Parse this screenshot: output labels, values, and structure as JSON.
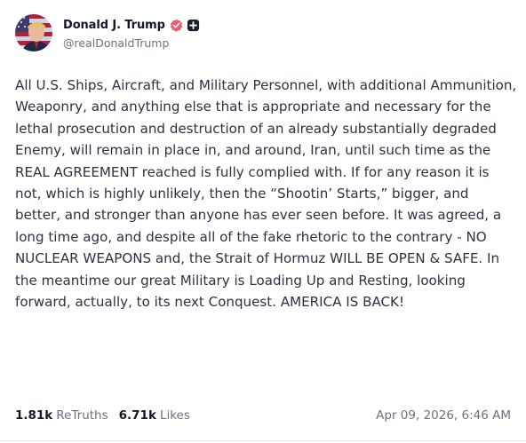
{
  "author": {
    "name": "Donald J. Trump",
    "handle": "@realDonaldTrump",
    "verified_color": "#ef5a6f"
  },
  "post": {
    "text": "All U.S. Ships, Aircraft, and Military Personnel, with additional Ammunition, Weaponry, and anything else that is appropriate and necessary for the lethal prosecution and destruction of an already substantially degraded Enemy, will remain in place in, and around, Iran, until such time as the REAL AGREEMENT reached is fully complied with. If for any reason it is not, which is highly unlikely, then the “Shootin’ Starts,” bigger, and better, and stronger than anyone has ever seen before. It was agreed, a long time ago, and despite all of the fake rhetoric to the contrary - NO NUCLEAR WEAPONS and, the Strait of Hormuz WILL BE OPEN & SAFE. In the meantime our great Military is Loading Up and Resting, looking forward, actually, to its next Conquest. AMERICA IS BACK!"
  },
  "stats": {
    "retruths_count": "1.81k",
    "retruths_label": "ReTruths",
    "likes_count": "6.71k",
    "likes_label": "Likes"
  },
  "timestamp": "Apr 09, 2026, 6:46 AM",
  "icons": {
    "verified": "verified-badge-icon",
    "plus": "plus-badge-icon"
  }
}
